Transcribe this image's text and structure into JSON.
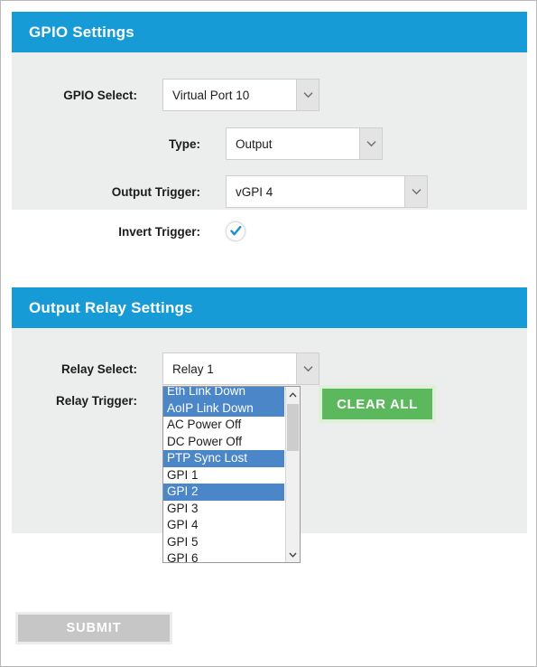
{
  "gpio_panel": {
    "title": "GPIO Settings",
    "rows": {
      "gpio_select": {
        "label": "GPIO Select:",
        "value": "Virtual Port 10"
      },
      "type": {
        "label": "Type:",
        "value": "Output"
      },
      "output_trigger": {
        "label": "Output Trigger:",
        "value": "vGPI 4"
      },
      "invert_trigger": {
        "label": "Invert Trigger:",
        "checked": true,
        "icon": "check-icon"
      }
    }
  },
  "relay_panel": {
    "title": "Output Relay Settings",
    "rows": {
      "relay_select": {
        "label": "Relay Select:",
        "value": "Relay 1"
      },
      "relay_trigger": {
        "label": "Relay Trigger:"
      }
    },
    "relay_trigger_options": [
      {
        "label": "Eth Link Down",
        "selected": true
      },
      {
        "label": "AoIP Link Down",
        "selected": true
      },
      {
        "label": "AC Power Off",
        "selected": false
      },
      {
        "label": "DC Power Off",
        "selected": false
      },
      {
        "label": "PTP Sync Lost",
        "selected": true
      },
      {
        "label": "GPI 1",
        "selected": false
      },
      {
        "label": "GPI 2",
        "selected": true
      },
      {
        "label": "GPI 3",
        "selected": false
      },
      {
        "label": "GPI 4",
        "selected": false
      },
      {
        "label": "GPI 5",
        "selected": false
      },
      {
        "label": "GPI 6",
        "selected": false
      }
    ],
    "clear_all_label": "CLEAR ALL"
  },
  "submit_label": "SUBMIT",
  "colors": {
    "header_blue": "#179bd7",
    "panel_gray": "#eceded",
    "selection_blue": "#4a86c8",
    "clear_green": "#5cb85c",
    "clear_green_halo": "#dff0d8",
    "submit_gray": "#c6c6c6",
    "check_blue": "#1b8fd4"
  },
  "icons": {
    "dropdown": "chevron-down-icon",
    "scroll_up": "chevron-up-icon",
    "scroll_down": "chevron-down-icon"
  }
}
